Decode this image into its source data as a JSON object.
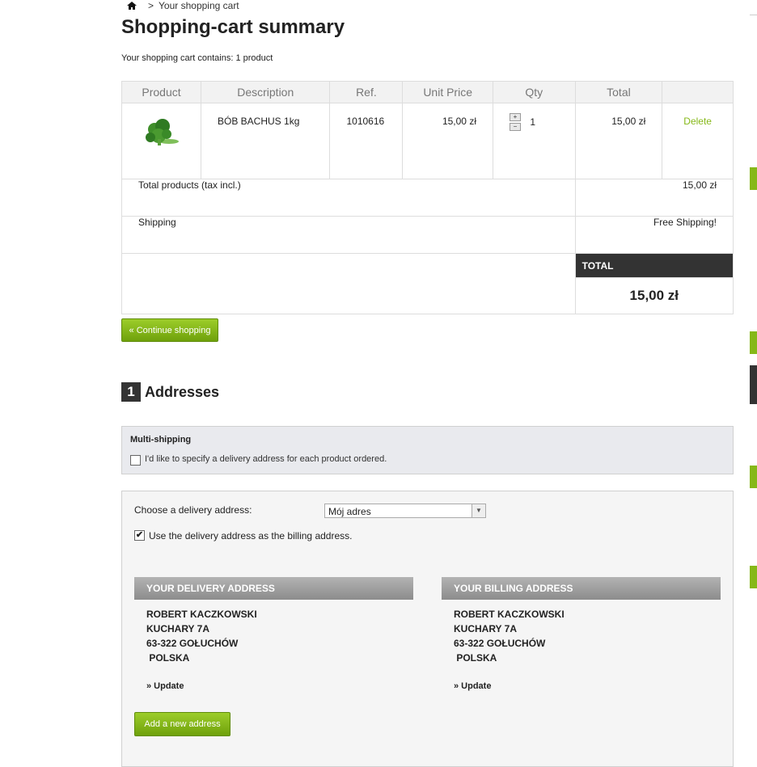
{
  "breadcrumb": {
    "separator": ">",
    "current": "Your shopping cart"
  },
  "page_title": "Shopping-cart summary",
  "cart_count_text": "Your shopping cart contains: 1 product",
  "table": {
    "headers": [
      "Product",
      "Description",
      "Ref.",
      "Unit Price",
      "Qty",
      "Total",
      ""
    ],
    "item": {
      "description": "BÓB BACHUS 1kg",
      "ref": "1010616",
      "unit_price": "15,00 zł",
      "qty": "1",
      "total": "15,00 zł",
      "delete": "Delete",
      "qty_up": "+",
      "qty_down": "−"
    },
    "total_products_label": "Total products (tax incl.)",
    "total_products_value": "15,00 zł",
    "shipping_label": "Shipping",
    "shipping_value": "Free Shipping!",
    "total_label": "TOTAL",
    "total_value": "15,00 zł"
  },
  "continue_shopping": "« Continue shopping",
  "addresses": {
    "step_number": "1",
    "title": "Addresses",
    "multi_shipping_title": "Multi-shipping",
    "multi_shipping_label": "I'd like to specify a delivery address for each product ordered.",
    "choose_label": "Choose a delivery address:",
    "selected_address": "Mój adres",
    "use_same_label": "Use the delivery address as the billing address.",
    "delivery": {
      "heading": "YOUR DELIVERY ADDRESS",
      "lines": [
        "ROBERT KACZKOWSKI",
        "KUCHARY 7A",
        "63-322 GOŁUCHÓW",
        " POLSKA"
      ],
      "update": "» Update"
    },
    "billing": {
      "heading": "YOUR BILLING ADDRESS",
      "lines": [
        "ROBERT KACZKOWSKI",
        "KUCHARY 7A",
        "63-322 GOŁUCHÓW",
        " POLSKA"
      ],
      "update": "» Update"
    },
    "add_new": "Add a new address"
  },
  "colors": {
    "accent_green": "#86b818",
    "dark": "#333333"
  }
}
